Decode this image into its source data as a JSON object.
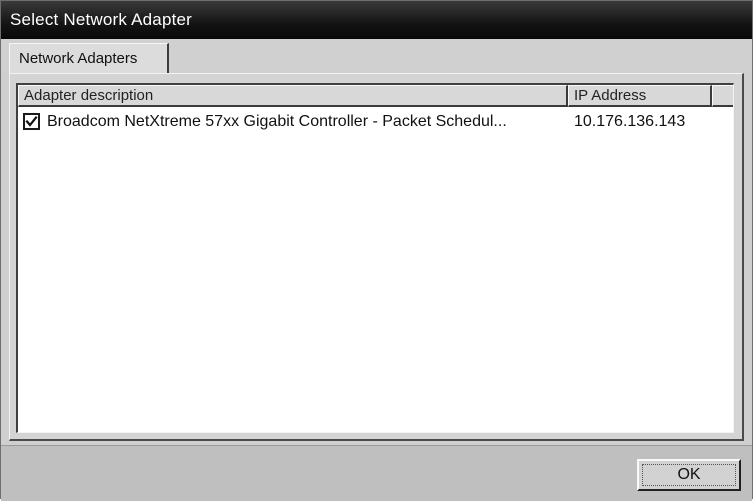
{
  "window": {
    "title": "Select Network Adapter"
  },
  "tabs": [
    {
      "label": "Network Adapters",
      "active": true
    }
  ],
  "list": {
    "columns": [
      {
        "label": "Adapter description"
      },
      {
        "label": "IP Address"
      }
    ],
    "rows": [
      {
        "checked": true,
        "description": "Broadcom NetXtreme 57xx Gigabit Controller - Packet Schedul...",
        "ip": "10.176.136.143"
      }
    ]
  },
  "buttons": {
    "ok_label": "OK"
  },
  "icons": {
    "checkbox_mark": "check-icon"
  }
}
